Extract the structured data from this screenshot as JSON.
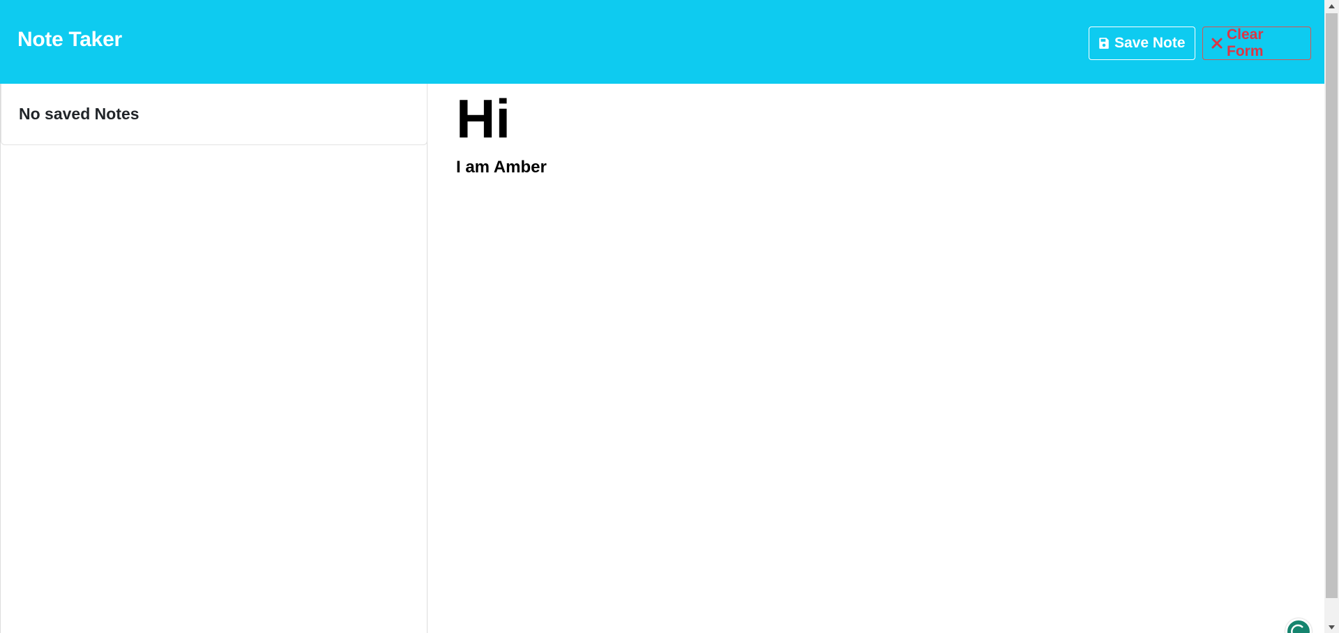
{
  "navbar": {
    "brand": "Note Taker",
    "background_color": "#0ecbf0",
    "save_button": {
      "label": "Save Note",
      "icon": "floppy-disk-icon"
    },
    "clear_button": {
      "label": "Clear Form",
      "icon": "x-icon",
      "color": "#dc3545"
    }
  },
  "sidebar": {
    "empty_message": "No saved Notes"
  },
  "note": {
    "title": "Hi",
    "body": "I am Amber"
  },
  "extension": {
    "icon": "grammarly-icon"
  }
}
